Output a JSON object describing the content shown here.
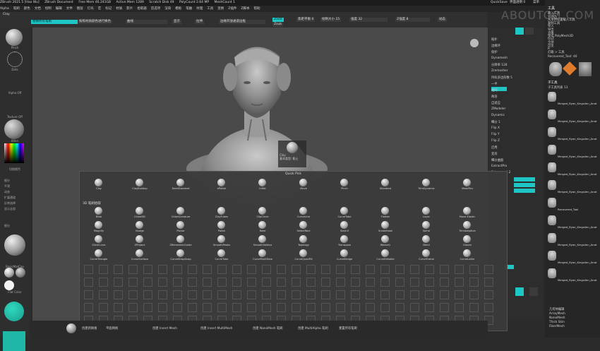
{
  "titlebar": {
    "items": [
      "ZBrush 2021.5 [Hao Wu]",
      "ZBrush Document",
      "Free Mem 46.241GB",
      "Active Mem 1289",
      "Scratch Disk 49",
      "PolyCount 2.64 MP",
      "MeshCount 1"
    ],
    "quicksave": "QuickSave",
    "ui_label": "界面透明 0",
    "menu_label": "菜单",
    "script": "DefaultZScript"
  },
  "menubar": {
    "items": [
      "Alpha",
      "笔刷",
      "颜色",
      "文档",
      "绘制",
      "编辑",
      "文件",
      "图层",
      "灯光",
      "宏",
      "标记",
      "材质",
      "影片",
      "拾取器",
      "首选项",
      "渲染",
      "模板",
      "笔触",
      "纹理",
      "工具",
      "变换",
      "Z插件",
      "Z脚本",
      "帮助"
    ]
  },
  "toolbar": {
    "brush_name": "Clay",
    "replace_label": "替换所有笔刷",
    "double_label": "按照材质颜色进行换色",
    "seq_label": "曲线",
    "all_label": "显示",
    "strips_label": "拉伸",
    "grid_label": "边缘",
    "edge_label": "边缘开放通道边框",
    "zadd_label": "Zadd",
    "zsub_label": "Zsub",
    "mrgb_label": "Mrgb",
    "rgb_label": "Rgb",
    "m_label": "M",
    "focal_label": "焦距平衡",
    "focal_value": "0",
    "draw_label": "绘制大小",
    "draw_value": "15",
    "intensity_label": "强度",
    "intensity_value": "32",
    "zintensity_label": "Z强度",
    "zintensity_value": "8",
    "dynamic_label": "动态"
  },
  "left_panel": {
    "brush_label": "Pinch",
    "stroke_label": "Dots",
    "alpha_label": "Alpha Off",
    "texture_label": "Texture Off",
    "material_label": "Blinn",
    "gradient_label": "渐变",
    "switch_label": "切换颜色",
    "basic_material": "BasicMatCap",
    "skin_material": "SkinShade4",
    "flat_material": "Flat Color",
    "menu_items": [
      "细分",
      "平滑",
      "动态",
      "扩展通道",
      "反转选择",
      "显示全部"
    ],
    "subdiv_label": "细分",
    "brush_size": "16"
  },
  "viewport": {
    "tooltip_name": "Clay",
    "tooltip_type": "基本类型: 黏土"
  },
  "quickpick": {
    "title": "Quick Pick",
    "section_label": "3D 笔刷拾取",
    "row1": [
      "Clay",
      "ClayBuildup",
      "DamStandard",
      "hPolish",
      "Inflat",
      "Move",
      "Pinch",
      "Standard",
      "TrimDynamic",
      "MaskPen"
    ],
    "row2": [
      "Blob",
      "Chisel3D",
      "ChiselCreature",
      "ClayTubes",
      "ClipCircle",
      "CurveLine",
      "CurveTube",
      "Flatten",
      "Layer",
      "Move Elastic"
    ],
    "row3": [
      "Magnify",
      "Nudge",
      "Planar",
      "Polish",
      "Rake",
      "SelectRect",
      "Slash3",
      "SnakeHook",
      "Spiral",
      "TrimAdaptive"
    ],
    "row4": [
      "SliceCurve",
      "ZProject",
      "ZRemesherGuide",
      "SmoothPeaks",
      "SmoothValleys",
      "Topology",
      "Transpose",
      "Weave1",
      "Bend",
      "Groom"
    ],
    "row5": [
      "CurveTriangle",
      "CurveSurface",
      "CurveStrapSnap",
      "CurveTube",
      "CurveMultiTube",
      "CurveQuadFill",
      "CurveBridge",
      "CurveEditable",
      "CurveFrame",
      "CurveLathe"
    ]
  },
  "right_mid": {
    "items": [
      "拓扑",
      "边缘环",
      "保护",
      "Dynamesh",
      "分辨率 128",
      "Zremesher",
      "目标多边形数 5",
      "一半",
      "相同",
      "两倍",
      "自适应",
      "ZModeler",
      "Dynamic",
      "细分 1",
      "Flip X",
      "Flip Y",
      "Flip Z",
      "启用",
      "变形",
      "细分曲面",
      "ExtractPro",
      "Polygons 4.2"
    ],
    "value_a": "128",
    "value_b": "5"
  },
  "right_panel": {
    "title": "工具",
    "items": [
      "载入工具",
      "另存为",
      "从项目设置载入工具",
      "复制工具",
      "导入",
      "导出",
      "克隆",
      "生成 PolyMesh3D",
      "GoZ",
      "全部",
      "可见",
      "R",
      "灯箱 > 工具"
    ],
    "tool_name": "Recovered_Tool: 46",
    "subtool_label": "子工具",
    "subtool_count": "子工具列表 13",
    "subtools": [
      "Merged_Ryan_Kingslien_Anat",
      "Merged_Ryan_Kingslien_Anat",
      "Merged_Ryan_Kingslien_Anat",
      "Merged_Ryan_Kingslien_Anat",
      "Merged_Ryan_Kingslien_Anat",
      "Merged_Ryan_Kingslien_Anat",
      "Recovered_Tool",
      "Merged_Ryan_Kingslien_Anat",
      "Merged_Ryan_Kingslien_Anat",
      "Merged_Ryan_Kingslien_Anat",
      "Merged_Ryan_Kingslien_Anat"
    ],
    "lower": [
      "几何体编辑",
      "ArrayMesh",
      "NanoMesh",
      "Thick Skin",
      "FiberMesh"
    ]
  },
  "bottombar": {
    "items": [
      "创建新网格",
      "平面网格",
      "创建 Insert Mesh",
      "创建 Insert MultiMesh",
      "创建 NanoMesh 笔刷",
      "创建 MultiAlpha 笔刷",
      "重置所有笔刷"
    ]
  },
  "watermark": "ABOUTCG.COM",
  "colors": {
    "accent": "#1ec6c6",
    "bg": "#2b2b2b",
    "viewport": "#4a4a4a"
  }
}
